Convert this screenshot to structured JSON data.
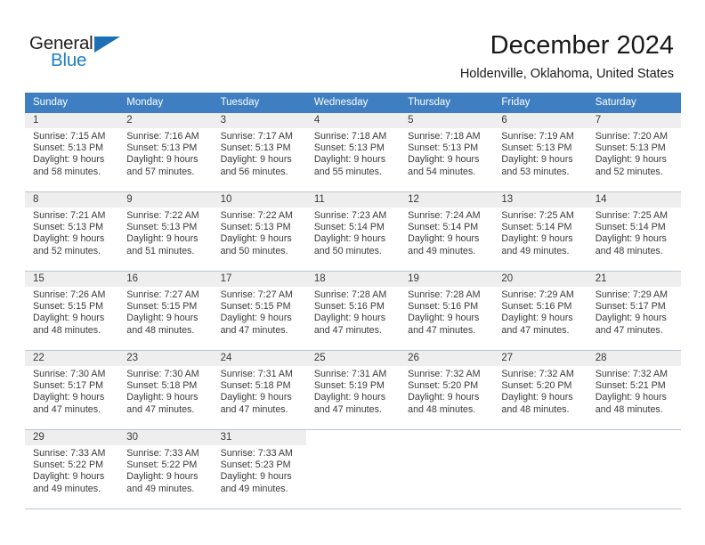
{
  "brand": {
    "name_part1": "General",
    "name_part2": "Blue",
    "triangle_color": "#1a6fb5",
    "blue_color": "#1f7ec4"
  },
  "header": {
    "title": "December 2024",
    "subtitle": "Holdenville, Oklahoma, United States"
  },
  "colors": {
    "header_bar": "#3f7fc1",
    "day_number_band": "#eeeeee",
    "grid_line": "#b9c6d4",
    "text": "#3a3a3a"
  },
  "weekdays": [
    "Sunday",
    "Monday",
    "Tuesday",
    "Wednesday",
    "Thursday",
    "Friday",
    "Saturday"
  ],
  "weeks": [
    [
      {
        "day": "1",
        "sunrise": "Sunrise: 7:15 AM",
        "sunset": "Sunset: 5:13 PM",
        "daylight1": "Daylight: 9 hours",
        "daylight2": "and 58 minutes."
      },
      {
        "day": "2",
        "sunrise": "Sunrise: 7:16 AM",
        "sunset": "Sunset: 5:13 PM",
        "daylight1": "Daylight: 9 hours",
        "daylight2": "and 57 minutes."
      },
      {
        "day": "3",
        "sunrise": "Sunrise: 7:17 AM",
        "sunset": "Sunset: 5:13 PM",
        "daylight1": "Daylight: 9 hours",
        "daylight2": "and 56 minutes."
      },
      {
        "day": "4",
        "sunrise": "Sunrise: 7:18 AM",
        "sunset": "Sunset: 5:13 PM",
        "daylight1": "Daylight: 9 hours",
        "daylight2": "and 55 minutes."
      },
      {
        "day": "5",
        "sunrise": "Sunrise: 7:18 AM",
        "sunset": "Sunset: 5:13 PM",
        "daylight1": "Daylight: 9 hours",
        "daylight2": "and 54 minutes."
      },
      {
        "day": "6",
        "sunrise": "Sunrise: 7:19 AM",
        "sunset": "Sunset: 5:13 PM",
        "daylight1": "Daylight: 9 hours",
        "daylight2": "and 53 minutes."
      },
      {
        "day": "7",
        "sunrise": "Sunrise: 7:20 AM",
        "sunset": "Sunset: 5:13 PM",
        "daylight1": "Daylight: 9 hours",
        "daylight2": "and 52 minutes."
      }
    ],
    [
      {
        "day": "8",
        "sunrise": "Sunrise: 7:21 AM",
        "sunset": "Sunset: 5:13 PM",
        "daylight1": "Daylight: 9 hours",
        "daylight2": "and 52 minutes."
      },
      {
        "day": "9",
        "sunrise": "Sunrise: 7:22 AM",
        "sunset": "Sunset: 5:13 PM",
        "daylight1": "Daylight: 9 hours",
        "daylight2": "and 51 minutes."
      },
      {
        "day": "10",
        "sunrise": "Sunrise: 7:22 AM",
        "sunset": "Sunset: 5:13 PM",
        "daylight1": "Daylight: 9 hours",
        "daylight2": "and 50 minutes."
      },
      {
        "day": "11",
        "sunrise": "Sunrise: 7:23 AM",
        "sunset": "Sunset: 5:14 PM",
        "daylight1": "Daylight: 9 hours",
        "daylight2": "and 50 minutes."
      },
      {
        "day": "12",
        "sunrise": "Sunrise: 7:24 AM",
        "sunset": "Sunset: 5:14 PM",
        "daylight1": "Daylight: 9 hours",
        "daylight2": "and 49 minutes."
      },
      {
        "day": "13",
        "sunrise": "Sunrise: 7:25 AM",
        "sunset": "Sunset: 5:14 PM",
        "daylight1": "Daylight: 9 hours",
        "daylight2": "and 49 minutes."
      },
      {
        "day": "14",
        "sunrise": "Sunrise: 7:25 AM",
        "sunset": "Sunset: 5:14 PM",
        "daylight1": "Daylight: 9 hours",
        "daylight2": "and 48 minutes."
      }
    ],
    [
      {
        "day": "15",
        "sunrise": "Sunrise: 7:26 AM",
        "sunset": "Sunset: 5:15 PM",
        "daylight1": "Daylight: 9 hours",
        "daylight2": "and 48 minutes."
      },
      {
        "day": "16",
        "sunrise": "Sunrise: 7:27 AM",
        "sunset": "Sunset: 5:15 PM",
        "daylight1": "Daylight: 9 hours",
        "daylight2": "and 48 minutes."
      },
      {
        "day": "17",
        "sunrise": "Sunrise: 7:27 AM",
        "sunset": "Sunset: 5:15 PM",
        "daylight1": "Daylight: 9 hours",
        "daylight2": "and 47 minutes."
      },
      {
        "day": "18",
        "sunrise": "Sunrise: 7:28 AM",
        "sunset": "Sunset: 5:16 PM",
        "daylight1": "Daylight: 9 hours",
        "daylight2": "and 47 minutes."
      },
      {
        "day": "19",
        "sunrise": "Sunrise: 7:28 AM",
        "sunset": "Sunset: 5:16 PM",
        "daylight1": "Daylight: 9 hours",
        "daylight2": "and 47 minutes."
      },
      {
        "day": "20",
        "sunrise": "Sunrise: 7:29 AM",
        "sunset": "Sunset: 5:16 PM",
        "daylight1": "Daylight: 9 hours",
        "daylight2": "and 47 minutes."
      },
      {
        "day": "21",
        "sunrise": "Sunrise: 7:29 AM",
        "sunset": "Sunset: 5:17 PM",
        "daylight1": "Daylight: 9 hours",
        "daylight2": "and 47 minutes."
      }
    ],
    [
      {
        "day": "22",
        "sunrise": "Sunrise: 7:30 AM",
        "sunset": "Sunset: 5:17 PM",
        "daylight1": "Daylight: 9 hours",
        "daylight2": "and 47 minutes."
      },
      {
        "day": "23",
        "sunrise": "Sunrise: 7:30 AM",
        "sunset": "Sunset: 5:18 PM",
        "daylight1": "Daylight: 9 hours",
        "daylight2": "and 47 minutes."
      },
      {
        "day": "24",
        "sunrise": "Sunrise: 7:31 AM",
        "sunset": "Sunset: 5:18 PM",
        "daylight1": "Daylight: 9 hours",
        "daylight2": "and 47 minutes."
      },
      {
        "day": "25",
        "sunrise": "Sunrise: 7:31 AM",
        "sunset": "Sunset: 5:19 PM",
        "daylight1": "Daylight: 9 hours",
        "daylight2": "and 47 minutes."
      },
      {
        "day": "26",
        "sunrise": "Sunrise: 7:32 AM",
        "sunset": "Sunset: 5:20 PM",
        "daylight1": "Daylight: 9 hours",
        "daylight2": "and 48 minutes."
      },
      {
        "day": "27",
        "sunrise": "Sunrise: 7:32 AM",
        "sunset": "Sunset: 5:20 PM",
        "daylight1": "Daylight: 9 hours",
        "daylight2": "and 48 minutes."
      },
      {
        "day": "28",
        "sunrise": "Sunrise: 7:32 AM",
        "sunset": "Sunset: 5:21 PM",
        "daylight1": "Daylight: 9 hours",
        "daylight2": "and 48 minutes."
      }
    ],
    [
      {
        "day": "29",
        "sunrise": "Sunrise: 7:33 AM",
        "sunset": "Sunset: 5:22 PM",
        "daylight1": "Daylight: 9 hours",
        "daylight2": "and 49 minutes."
      },
      {
        "day": "30",
        "sunrise": "Sunrise: 7:33 AM",
        "sunset": "Sunset: 5:22 PM",
        "daylight1": "Daylight: 9 hours",
        "daylight2": "and 49 minutes."
      },
      {
        "day": "31",
        "sunrise": "Sunrise: 7:33 AM",
        "sunset": "Sunset: 5:23 PM",
        "daylight1": "Daylight: 9 hours",
        "daylight2": "and 49 minutes."
      },
      {
        "day": "",
        "sunrise": "",
        "sunset": "",
        "daylight1": "",
        "daylight2": ""
      },
      {
        "day": "",
        "sunrise": "",
        "sunset": "",
        "daylight1": "",
        "daylight2": ""
      },
      {
        "day": "",
        "sunrise": "",
        "sunset": "",
        "daylight1": "",
        "daylight2": ""
      },
      {
        "day": "",
        "sunrise": "",
        "sunset": "",
        "daylight1": "",
        "daylight2": ""
      }
    ]
  ]
}
